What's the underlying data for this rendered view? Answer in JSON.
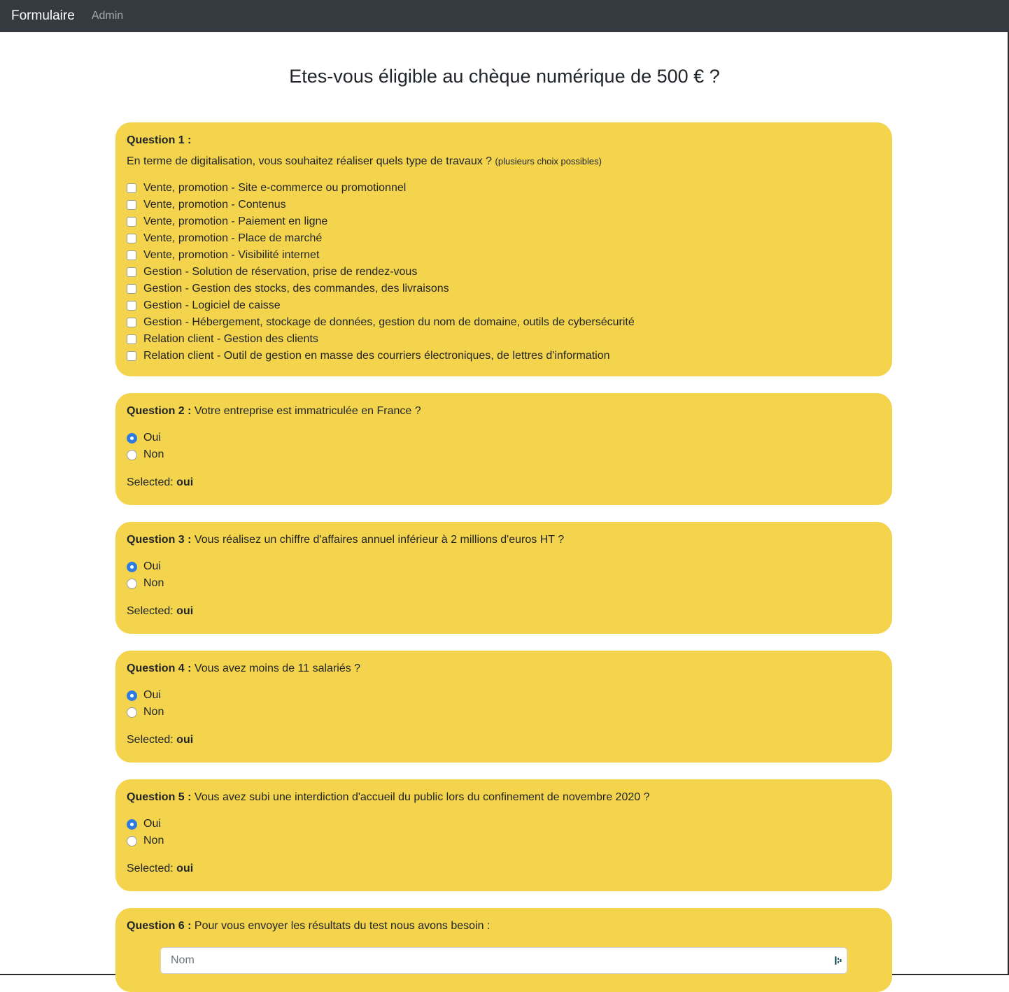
{
  "navbar": {
    "brand": "Formulaire",
    "link": "Admin"
  },
  "title": "Etes-vous éligible au chèque numérique de 500 € ?",
  "q1": {
    "label": "Question 1 :",
    "text": "En terme de digitalisation, vous souhaitez réaliser quels type de travaux ?",
    "hint": "(plusieurs choix possibles)",
    "options": [
      "Vente, promotion - Site e-commerce ou promotionnel",
      "Vente, promotion - Contenus",
      "Vente, promotion - Paiement en ligne",
      "Vente, promotion - Place de marché",
      "Vente, promotion - Visibilité internet",
      "Gestion - Solution de réservation, prise de rendez-vous",
      "Gestion - Gestion des stocks, des commandes, des livraisons",
      "Gestion - Logiciel de caisse",
      "Gestion - Hébergement, stockage de données, gestion du nom de domaine, outils de cybersécurité",
      "Relation client - Gestion des clients",
      "Relation client - Outil de gestion en masse des courriers électroniques, de lettres d'information"
    ]
  },
  "q2": {
    "label": "Question 2 :",
    "text": "Votre entreprise est immatriculée en France ?",
    "oui": "Oui",
    "non": "Non",
    "selected_label": "Selected:",
    "selected_value": "oui"
  },
  "q3": {
    "label": "Question 3 :",
    "text": "Vous réalisez un chiffre d'affaires annuel inférieur à 2 millions d'euros HT ?",
    "oui": "Oui",
    "non": "Non",
    "selected_label": "Selected:",
    "selected_value": "oui"
  },
  "q4": {
    "label": "Question 4 :",
    "text": "Vous avez moins de 11 salariés ?",
    "oui": "Oui",
    "non": "Non",
    "selected_label": "Selected:",
    "selected_value": "oui"
  },
  "q5": {
    "label": "Question 5 :",
    "text": "Vous avez subi une interdiction d'accueil du public lors du confinement de novembre 2020 ?",
    "oui": "Oui",
    "non": "Non",
    "selected_label": "Selected:",
    "selected_value": "oui"
  },
  "q6": {
    "label": "Question 6 :",
    "text": "Pour vous envoyer les résultats du test nous avons besoin :",
    "nom_placeholder": "Nom"
  },
  "colors": {
    "navbar": "#343a40",
    "card": "#f4d44d",
    "radio_checked": "#2f7de1"
  }
}
